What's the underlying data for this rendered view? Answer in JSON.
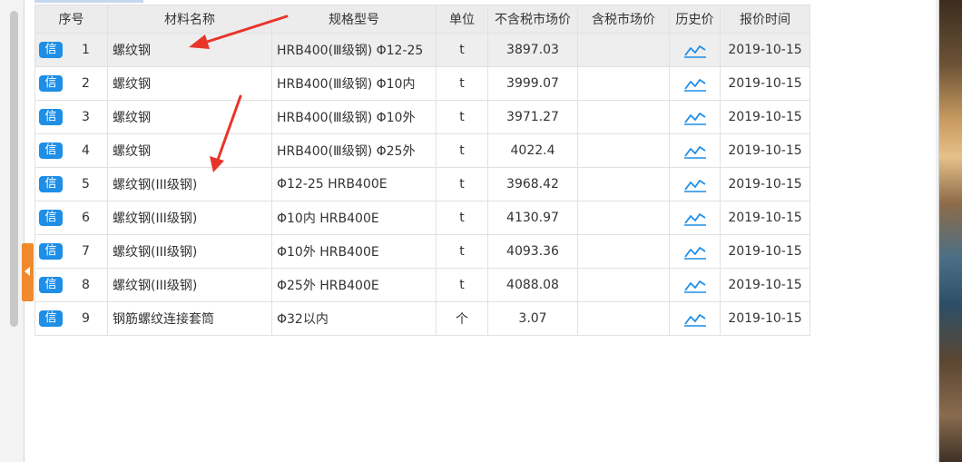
{
  "table": {
    "headers": {
      "idx": "序号",
      "name": "材料名称",
      "spec": "规格型号",
      "unit": "单位",
      "price": "不含税市场价",
      "tax_price": "含税市场价",
      "history": "历史价",
      "date": "报价时间"
    },
    "badge_label": "信",
    "rows": [
      {
        "no": "1",
        "name": "螺纹钢",
        "spec": "HRB400(Ⅲ级钢) Φ12-25",
        "unit": "t",
        "price": "3897.03",
        "tax_price": "",
        "date": "2019-10-15"
      },
      {
        "no": "2",
        "name": "螺纹钢",
        "spec": "HRB400(Ⅲ级钢) Φ10内",
        "unit": "t",
        "price": "3999.07",
        "tax_price": "",
        "date": "2019-10-15"
      },
      {
        "no": "3",
        "name": "螺纹钢",
        "spec": "HRB400(Ⅲ级钢) Φ10外",
        "unit": "t",
        "price": "3971.27",
        "tax_price": "",
        "date": "2019-10-15"
      },
      {
        "no": "4",
        "name": "螺纹钢",
        "spec": "HRB400(Ⅲ级钢) Φ25外",
        "unit": "t",
        "price": "4022.4",
        "tax_price": "",
        "date": "2019-10-15"
      },
      {
        "no": "5",
        "name": "螺纹钢(III级钢)",
        "spec": "Φ12-25 HRB400E",
        "unit": "t",
        "price": "3968.42",
        "tax_price": "",
        "date": "2019-10-15"
      },
      {
        "no": "6",
        "name": "螺纹钢(III级钢)",
        "spec": "Φ10内 HRB400E",
        "unit": "t",
        "price": "4130.97",
        "tax_price": "",
        "date": "2019-10-15"
      },
      {
        "no": "7",
        "name": "螺纹钢(III级钢)",
        "spec": "Φ10外 HRB400E",
        "unit": "t",
        "price": "4093.36",
        "tax_price": "",
        "date": "2019-10-15"
      },
      {
        "no": "8",
        "name": "螺纹钢(III级钢)",
        "spec": "Φ25外 HRB400E",
        "unit": "t",
        "price": "4088.08",
        "tax_price": "",
        "date": "2019-10-15"
      },
      {
        "no": "9",
        "name": "钢筋螺纹连接套筒",
        "spec": "Φ32以内",
        "unit": "个",
        "price": "3.07",
        "tax_price": "",
        "date": "2019-10-15"
      }
    ],
    "selected_row": "1"
  },
  "icons": {
    "history": "line-chart-icon",
    "collapse": "chevron-left-icon",
    "credit_badge": "credit-badge-icon"
  },
  "colors": {
    "badge_blue": "#1e8ee6",
    "chart_icon_blue": "#1e8ee6",
    "collapse_orange": "#f08a2d",
    "annotation_red": "#e8352b",
    "header_bg": "#ececec",
    "selected_row_bg": "#eeeeee"
  }
}
